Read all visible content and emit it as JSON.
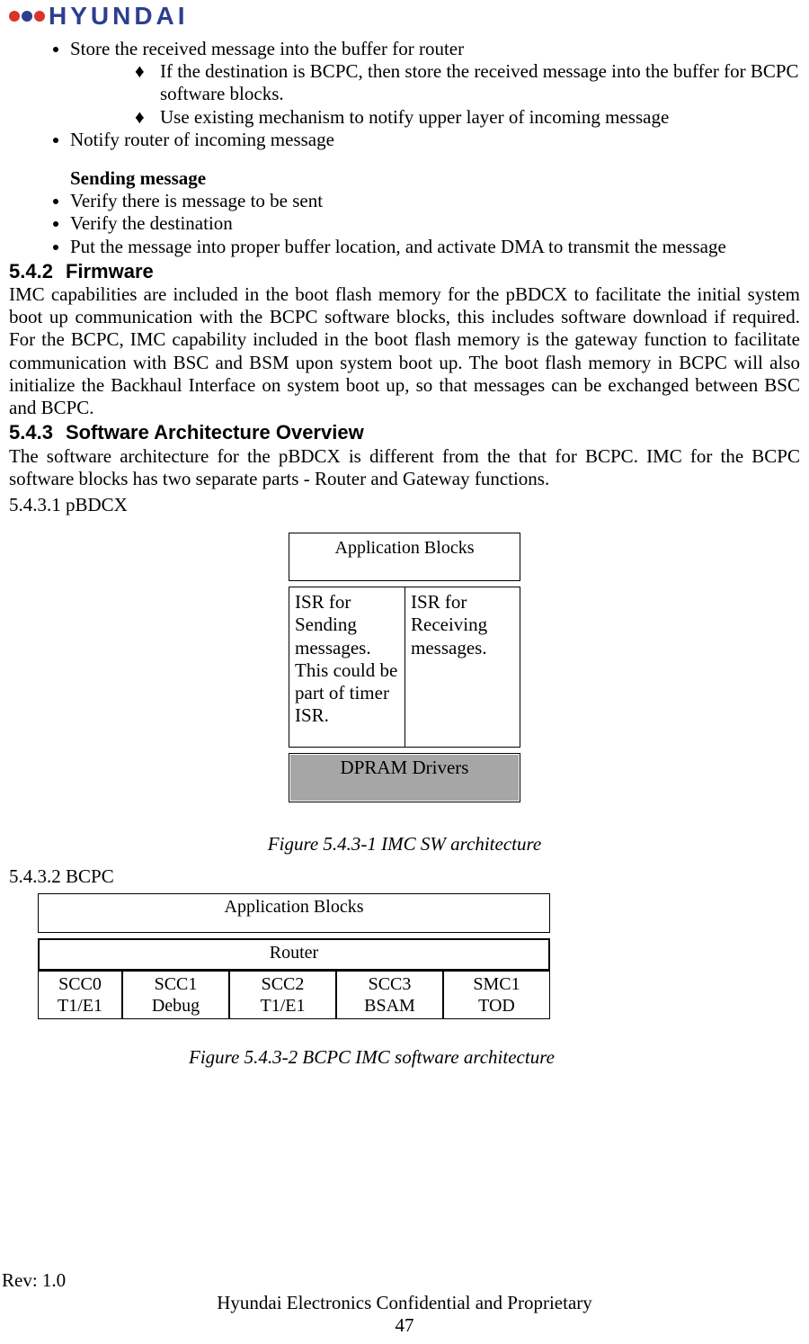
{
  "logo": {
    "text": "HYUNDAI"
  },
  "receiving": {
    "b1": "Store the received message into the buffer for router",
    "d1": "If the destination is BCPC, then store the received message into the buffer for BCPC software blocks.",
    "d2": "Use existing mechanism to notify upper layer of incoming message",
    "b2": "Notify router of incoming message"
  },
  "sending": {
    "title": "Sending message",
    "s1": "Verify there is message to be sent",
    "s2": "Verify the destination",
    "s3": "Put the message into proper buffer location, and activate DMA to transmit the message"
  },
  "sec542": {
    "num": "5.4.2",
    "title": "Firmware",
    "para": "IMC capabilities are included in the boot flash memory for the pBDCX to facilitate the initial system boot up communication with the BCPC software blocks, this includes software download if required.  For the BCPC, IMC capability included in the boot flash memory is the gateway function to facilitate communication with BSC and BSM upon system boot up.  The boot flash memory in BCPC will also initialize the Backhaul Interface on system boot up, so that messages can be exchanged between BSC and BCPC."
  },
  "sec543": {
    "num": "5.4.3",
    "title": "Software Architecture Overview",
    "para": "The software architecture for the pBDCX is different from the that for BCPC.  IMC for the BCPC software blocks  has two separate parts - Router and Gateway functions."
  },
  "sub5431": {
    "label": "5.4.3.1  pBDCX"
  },
  "diag1": {
    "app": "Application Blocks",
    "left": "ISR for Sending messages.  This could be part of timer ISR.",
    "right": "ISR for Receiving messages.",
    "bottom": "DPRAM Drivers",
    "caption": "Figure 5.4.3-1 IMC SW architecture"
  },
  "sub5432": {
    "label": "5.4.3.2  BCPC"
  },
  "diag2": {
    "app": "Application Blocks",
    "router": "Router",
    "cells": [
      {
        "l1": "SCC0",
        "l2": "T1/E1"
      },
      {
        "l1": "SCC1",
        "l2": "Debug"
      },
      {
        "l1": "SCC2",
        "l2": "T1/E1"
      },
      {
        "l1": "SCC3",
        "l2": "BSAM"
      },
      {
        "l1": "SMC1",
        "l2": "TOD"
      }
    ],
    "caption": "Figure 5.4.3-2 BCPC IMC software architecture"
  },
  "footer": {
    "rev": "Rev: 1.0",
    "conf": "Hyundai Electronics Confidential and Proprietary",
    "page": "47"
  }
}
